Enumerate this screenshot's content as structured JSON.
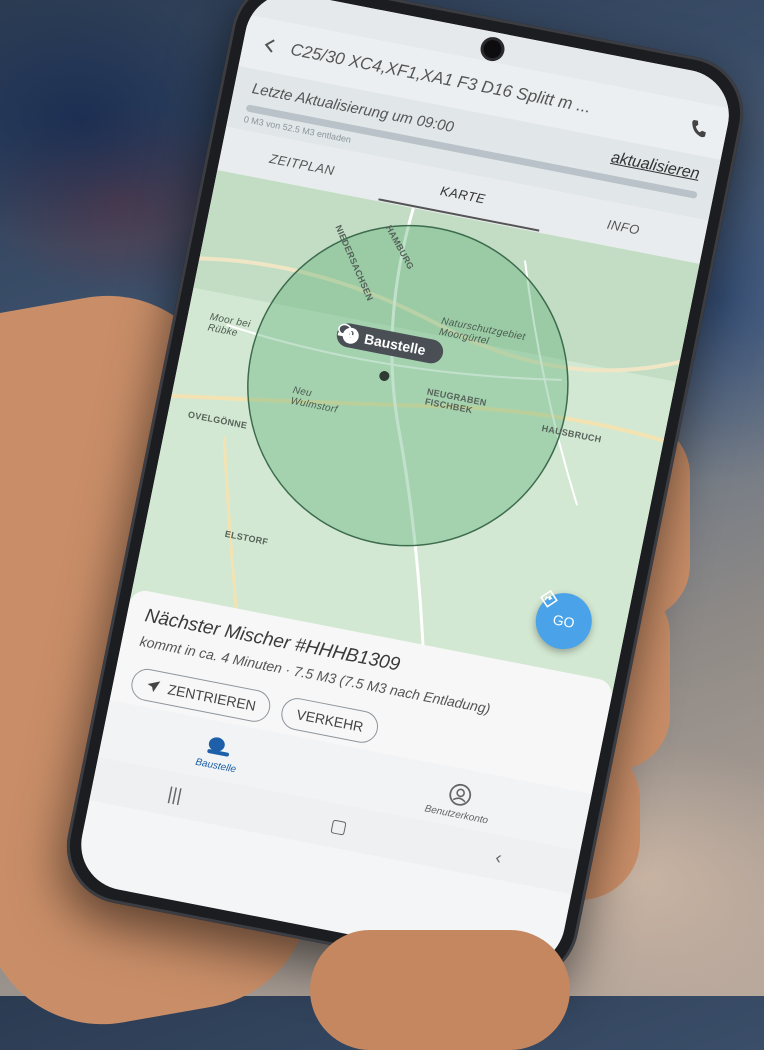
{
  "app": {
    "title": "C25/30 XC4,XF1,XA1 F3 D16 Splitt m ...",
    "last_update": "Letzte Aktualisierung um 09:00",
    "refresh_link": "aktualisieren",
    "progress_text": "0 M3 von 52.5 M3 entladen",
    "progress_fraction": 0.0
  },
  "tabs": [
    {
      "label": "ZEITPLAN"
    },
    {
      "label": "KARTE"
    },
    {
      "label": "INFO"
    }
  ],
  "map": {
    "labels": {
      "hamburg": "HAMBURG",
      "niedersachsen": "NIEDERSACHSEN",
      "naturschutz": "Naturschutzgebiet Moorgürtel",
      "neugraben": "NEUGRABEN FISCHBEK",
      "hausbruch": "HAUSBRUCH",
      "neu_wulmstorf": "Neu Wulmstorf",
      "ovelgonne": "OVELGÖNNE",
      "elstorf": "ELSTORF",
      "moor": "Moor bei Rübke"
    },
    "pin_label": "Baustelle",
    "pin_count": "0",
    "go_label": "GO"
  },
  "sheet": {
    "heading": "Nächster Mischer #HHHB1309",
    "eta": "kommt in ca. 4 Minuten",
    "volume": "7.5 M3 (7.5 M3 nach Entladung)",
    "btn_center": "ZENTRIEREN",
    "btn_traffic": "VERKEHR"
  },
  "nav": [
    {
      "label": "Baustelle"
    },
    {
      "label": "Benutzerkonto"
    }
  ],
  "colors": {
    "accent": "#1d5fa8",
    "go": "#4aa3e8",
    "map_green": "#cfe5cf"
  }
}
